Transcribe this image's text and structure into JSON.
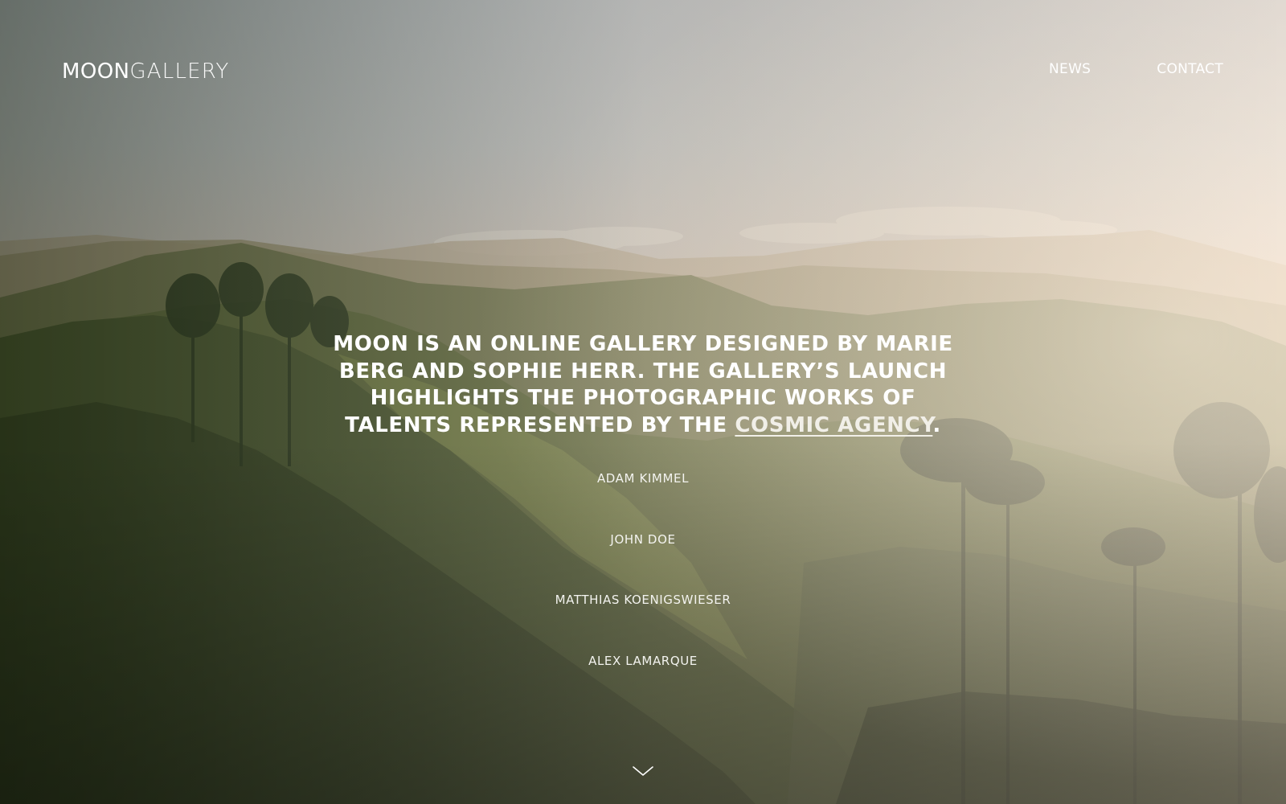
{
  "header": {
    "logo_strong": "MOON",
    "logo_light": "GALLERY",
    "nav": [
      {
        "label": "NEWS"
      },
      {
        "label": "CONTACT"
      }
    ]
  },
  "intro": {
    "text": "MOON IS AN ONLINE GALLERY DESIGNED BY MARIE BERG AND SOPHIE HERR. THE GALLERY’S LAUNCH HIGHLIGHTS THE PHOTOGRAPHIC WORKS OF TALENTS REPRESENTED BY THE ",
    "link_label": "COSMIC AGENCY",
    "suffix": "."
  },
  "artists": [
    {
      "name": "ADAM KIMMEL"
    },
    {
      "name": "JOHN DOE"
    },
    {
      "name": "MATTHIAS KOENIGSWIESER"
    },
    {
      "name": "ALEX LAMARQUE"
    }
  ],
  "icons": {
    "scroll": "chevron-down-icon"
  },
  "colors": {
    "text": "#ffffff",
    "sky_top": "#c6cbd3",
    "sky_horizon": "#e9d7c8",
    "hills_dark": "#2f3a22",
    "hills_mid": "#56653a"
  }
}
